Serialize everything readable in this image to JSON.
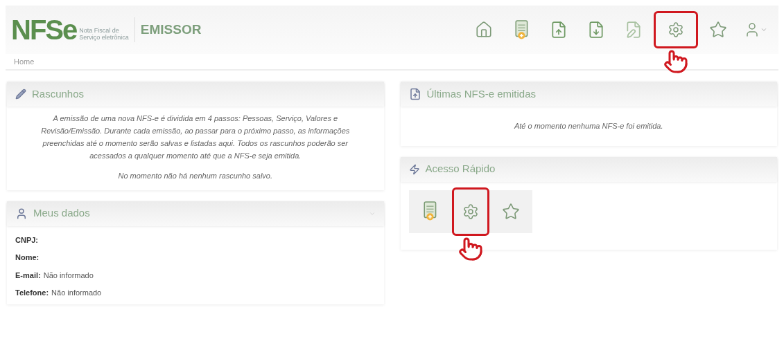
{
  "header": {
    "logo": {
      "mark": "NFSe",
      "tagline_1": "Nota Fiscal de",
      "tagline_2": "Serviço eletrônica"
    },
    "app_name": "EMISSOR"
  },
  "toolbar_buttons": [
    {
      "highlighted": false
    },
    {
      "highlighted": false
    },
    {
      "highlighted": false
    },
    {
      "highlighted": false
    },
    {
      "highlighted": false
    },
    {
      "highlighted": true
    },
    {
      "highlighted": false
    },
    {
      "highlighted": false
    }
  ],
  "breadcrumb": "Home",
  "drafts": {
    "title": "Rascunhos",
    "description": "A emissão de uma nova NFS-e é dividida em 4 passos: Pessoas, Serviço, Valores e Revisão/Emissão. Durante cada emissão, ao passar para o próximo passo, as informações preenchidas até o momento serão salvas e listadas aqui. Todos os rascunhos poderão ser acessados a qualquer momento até que a NFS-e seja emitida.",
    "empty_message": "No momento não há nenhum rascunho salvo."
  },
  "my_data": {
    "title": "Meus dados",
    "fields": [
      {
        "label": "CNPJ:"
      },
      {
        "label": "Nome:"
      },
      {
        "label": "E-mail:",
        "value": "Não informado"
      },
      {
        "label": "Telefone:",
        "value": "Não informado"
      }
    ]
  },
  "latest": {
    "title": "Últimas NFS-e emitidas",
    "empty_message": "Até o momento nenhuma NFS-e foi emitida."
  },
  "quick_access": {
    "title": "Acesso Rápido",
    "buttons": [
      {
        "highlighted": false
      },
      {
        "highlighted": true
      },
      {
        "highlighted": false
      }
    ]
  }
}
